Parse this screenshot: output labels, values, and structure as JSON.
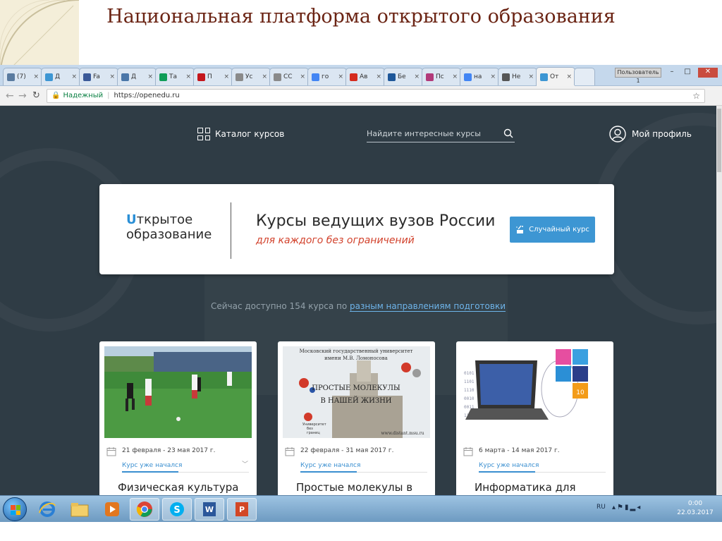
{
  "slide": {
    "title": "Национальная платформа открытого образования"
  },
  "browser": {
    "tabs": [
      {
        "label": "(7)",
        "icon": "vk-icon",
        "color": "#5a7ba0"
      },
      {
        "label": "Д",
        "icon": "openedu-icon",
        "color": "#3d96d3"
      },
      {
        "label": "Fa",
        "icon": "facebook-icon",
        "color": "#3b5998"
      },
      {
        "label": "Д",
        "icon": "vk-icon",
        "color": "#4a76a8"
      },
      {
        "label": "Та",
        "icon": "sheets-icon",
        "color": "#0f9d58"
      },
      {
        "label": "П",
        "icon": "hbr-icon",
        "color": "#c4161c"
      },
      {
        "label": "Ус",
        "icon": "page-icon",
        "color": "#8a8a8a"
      },
      {
        "label": "СС",
        "icon": "doc-icon",
        "color": "#8a8a8a"
      },
      {
        "label": "го",
        "icon": "google-icon",
        "color": "#4285f4"
      },
      {
        "label": "Ав",
        "icon": "flag-icon",
        "color": "#d52b1e"
      },
      {
        "label": "Бе",
        "icon": "s-icon",
        "color": "#1e5799"
      },
      {
        "label": "Пс",
        "icon": "mail-icon",
        "color": "#b23a7a"
      },
      {
        "label": "на",
        "icon": "google-icon",
        "color": "#4285f4"
      },
      {
        "label": "Не",
        "icon": "b-icon",
        "color": "#555555"
      },
      {
        "label": "От",
        "icon": "openedu-icon",
        "color": "#3d96d3"
      }
    ],
    "user_label": "Пользователь 1",
    "window_controls": [
      "–",
      "□",
      "✕"
    ],
    "address": {
      "secure_label": "Надежный",
      "url": "https://openedu.ru"
    }
  },
  "site": {
    "nav": {
      "catalog_label": "Каталог курсов",
      "search_placeholder": "Найдите интересные курсы",
      "profile_label": "Мой профиль"
    },
    "hero": {
      "logo_line1": "ткрытое",
      "logo_line2": "образование",
      "title": "Курсы ведущих вузов России",
      "subtitle": "для каждого без ограничений",
      "random_button": "Случайный курс"
    },
    "available": {
      "prefix": "Сейчас доступно 154 курса по ",
      "link": "разным направлениям подготовки"
    },
    "cards": [
      {
        "date": "21 февраля - 23 мая 2017 г.",
        "status": "Курс уже начался",
        "title": "Физическая культура"
      },
      {
        "date": "22 февраля - 31 мая 2017 г.",
        "status": "Курс уже начался",
        "title": "Простые молекулы в",
        "image_text": {
          "university_line1": "Московский государственный университет",
          "university_line2": "имени М.В. Ломоносова",
          "course_line1": "ПРОСТЫЕ МОЛЕКУЛЫ",
          "course_line2": "В НАШЕЙ ЖИЗНИ",
          "badge_line1": "Университет",
          "badge_line2": "без",
          "badge_line3": "границ",
          "site": "www.distant.msu.ru"
        }
      },
      {
        "date": "6 марта - 14 мая 2017 г.",
        "status": "Курс уже начался",
        "title": "Информатика для",
        "image_text": {
          "badge_number": "10"
        }
      }
    ]
  },
  "taskbar": {
    "language": "RU",
    "time": "0:00",
    "date": "22.03.2017"
  },
  "colors": {
    "accent": "#3d96d3",
    "subtitle": "#d2412b",
    "site_bg": "#2f3c45",
    "slide_title": "#6b2414"
  }
}
